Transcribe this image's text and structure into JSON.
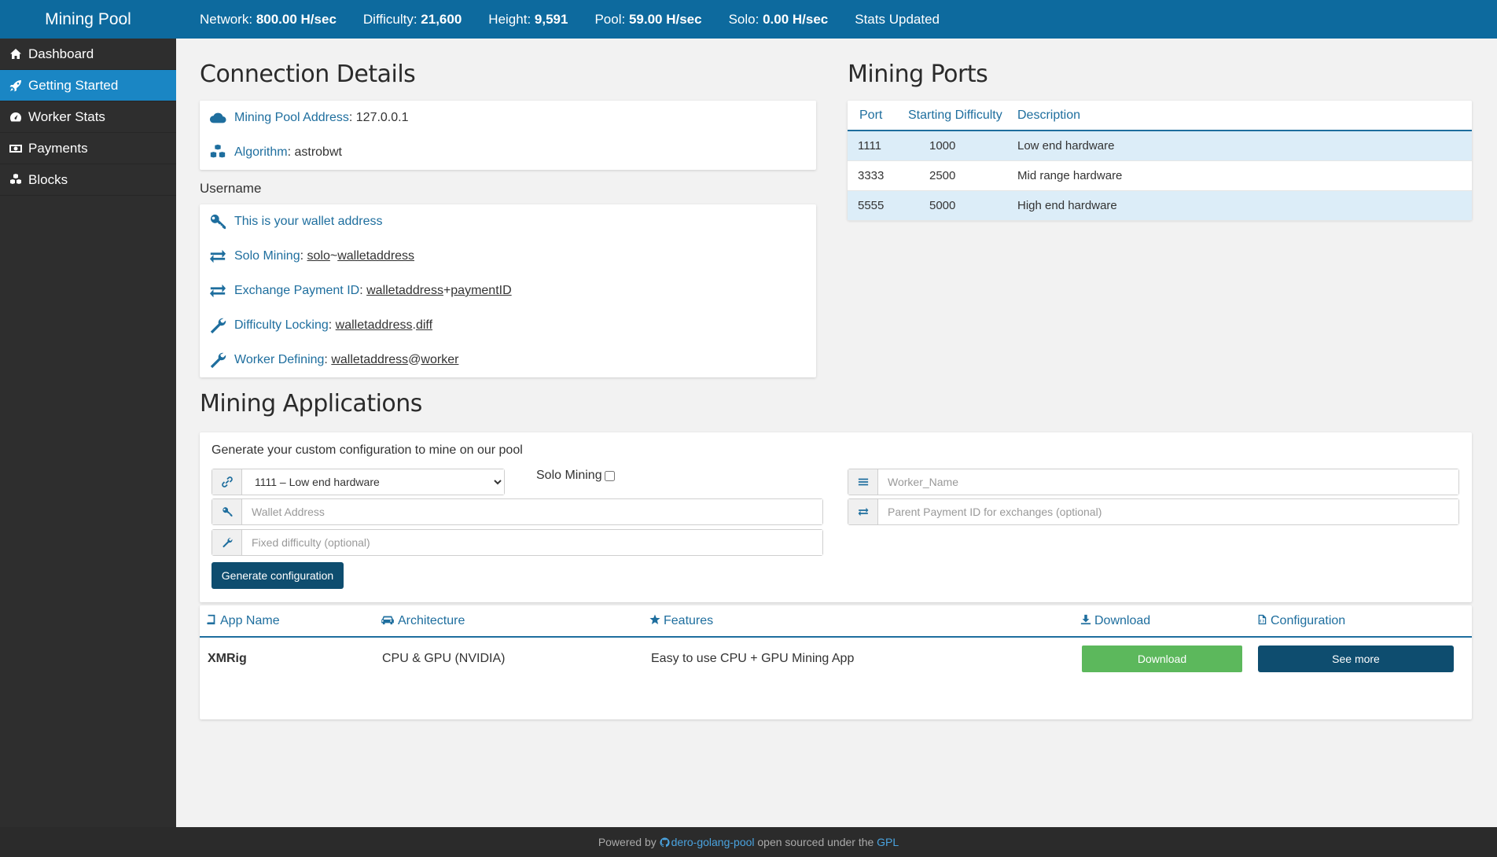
{
  "sidebar": {
    "brand": "Mining Pool",
    "items": [
      {
        "label": "Dashboard",
        "icon": "home-icon"
      },
      {
        "label": "Getting Started",
        "icon": "rocket-icon",
        "active": true
      },
      {
        "label": "Worker Stats",
        "icon": "tachometer-icon"
      },
      {
        "label": "Payments",
        "icon": "money-icon"
      },
      {
        "label": "Blocks",
        "icon": "cubes-icon"
      }
    ]
  },
  "topbar": {
    "network_label": "Network:",
    "network_value": "800.00 H/sec",
    "difficulty_label": "Difficulty:",
    "difficulty_value": "21,600",
    "height_label": "Height:",
    "height_value": "9,591",
    "pool_label": "Pool:",
    "pool_value": "59.00 H/sec",
    "solo_label": "Solo:",
    "solo_value": "0.00 H/sec",
    "stats_updated": "Stats Updated"
  },
  "connection": {
    "title": "Connection Details",
    "pool_address_label": "Mining Pool Address",
    "pool_address_value": "127.0.0.1",
    "algorithm_label": "Algorithm",
    "algorithm_value": "astrobwt",
    "username_heading": "Username",
    "wallet_hint": "This is your wallet address",
    "solo_label": "Solo Mining",
    "solo_prefix": "solo",
    "solo_sep": "~",
    "solo_suffix": "walletaddress",
    "exchange_label": "Exchange Payment ID",
    "exchange_prefix": "walletaddress",
    "exchange_sep": "+",
    "exchange_suffix": "paymentID",
    "difflock_label": "Difficulty Locking",
    "difflock_prefix": "walletaddress",
    "difflock_sep": ".",
    "difflock_suffix": "diff",
    "worker_label": "Worker Defining",
    "worker_prefix": "walletaddress",
    "worker_sep": "@",
    "worker_suffix": "worker",
    "colon": ":"
  },
  "ports": {
    "title": "Mining Ports",
    "headers": [
      "Port",
      "Starting Difficulty",
      "Description"
    ],
    "rows": [
      {
        "port": "1111",
        "difficulty": "1000",
        "description": "Low end hardware"
      },
      {
        "port": "3333",
        "difficulty": "2500",
        "description": "Mid range hardware"
      },
      {
        "port": "5555",
        "difficulty": "5000",
        "description": "High end hardware"
      }
    ]
  },
  "applications": {
    "title": "Mining Applications",
    "intro": "Generate your custom configuration to mine on our pool",
    "port_select_value": "1111 – Low end hardware",
    "solo_mining_label": "Solo Mining",
    "wallet_placeholder": "Wallet Address",
    "fixed_diff_placeholder": "Fixed difficulty (optional)",
    "worker_placeholder": "Worker_Name",
    "payment_id_placeholder": "Parent Payment ID for exchanges (optional)",
    "generate_button": "Generate configuration",
    "table_headers": {
      "app_name": "App Name",
      "architecture": "Architecture",
      "features": "Features",
      "download": "Download",
      "configuration": "Configuration"
    },
    "apps": [
      {
        "name": "XMRig",
        "architecture": "CPU & GPU (NVIDIA)",
        "features": "Easy to use CPU + GPU Mining App",
        "download_label": "Download",
        "config_label": "See more"
      }
    ]
  },
  "footer": {
    "powered_by": "Powered by",
    "project": "dero-golang-pool",
    "open_sourced": "open sourced under the",
    "license": "GPL"
  },
  "colors": {
    "brand": "#0d6a9e",
    "sidebar": "#2e2e2e",
    "active_nav": "#1a86c4",
    "accent_text": "#1e6e9e",
    "primary_button": "#0e4d6f",
    "success_button": "#5cb85c"
  }
}
